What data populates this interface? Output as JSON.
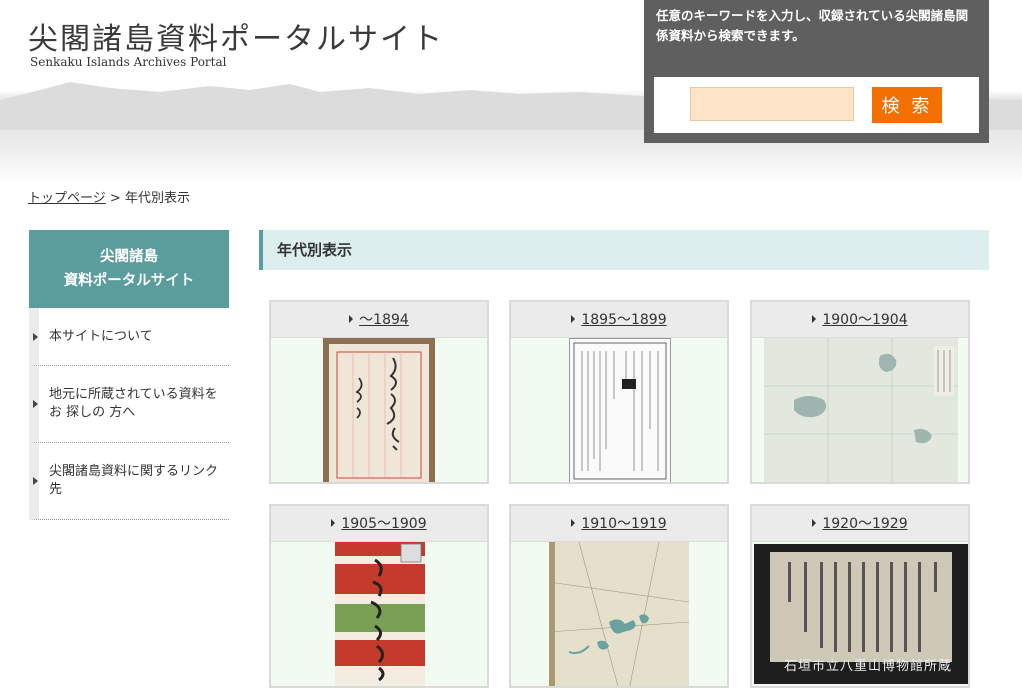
{
  "header": {
    "title": "尖閣諸島資料ポータルサイト",
    "subtitle": "Senkaku Islands Archives Portal"
  },
  "search": {
    "description": "任意のキーワードを入力し、収録されている尖閣諸島関係資料から検索できます。",
    "button_label": "検 索",
    "value": "",
    "placeholder": ""
  },
  "breadcrumb": {
    "home": "トップページ",
    "separator": ">",
    "current": "年代別表示"
  },
  "sidebar": {
    "heading_line1": "尖閣諸島",
    "heading_line2": "資料ポータルサイト",
    "items": [
      {
        "label": "本サイトについて"
      },
      {
        "label": "地元に所蔵されている資料をお 探しの 方へ"
      },
      {
        "label": "尖閣諸島資料に関するリンク先"
      }
    ]
  },
  "main": {
    "section_title": "年代別表示",
    "periods": [
      {
        "label": "～1894"
      },
      {
        "label": "1895～1899"
      },
      {
        "label": "1900～1904"
      },
      {
        "label": "1905～1909"
      },
      {
        "label": "1910～1919"
      },
      {
        "label": "1920～1929"
      }
    ],
    "credit": "石垣市立八重山博物館所蔵"
  },
  "colors": {
    "teal": "#5b9c9c",
    "search_button": "#f26f00",
    "search_panel": "#5f5f5f"
  }
}
